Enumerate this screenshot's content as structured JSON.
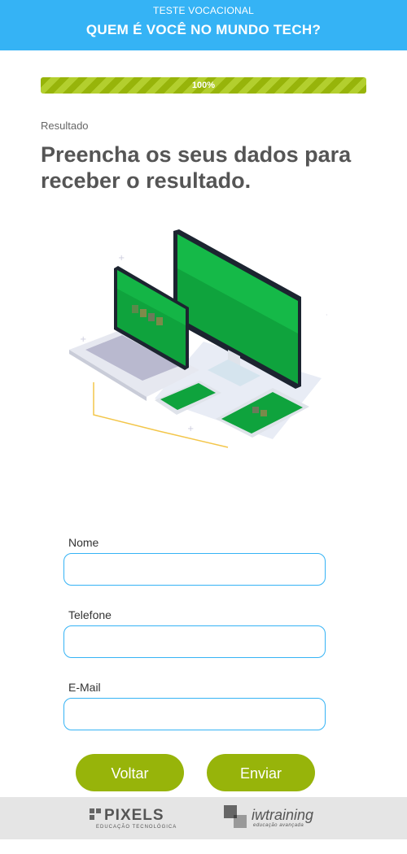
{
  "header": {
    "kicker": "TESTE VOCACIONAL",
    "title": "QUEM É VOCÊ NO MUNDO TECH?"
  },
  "progress": {
    "value": 100,
    "label": "100%"
  },
  "step": {
    "label": "Resultado"
  },
  "heading": "Preencha os seus dados para receber o resultado.",
  "illustration": {
    "icon": "devices-illustration"
  },
  "form": {
    "name_label": "Nome",
    "name_value": "",
    "phone_label": "Telefone",
    "phone_value": "",
    "email_label": "E-Mail",
    "email_value": ""
  },
  "buttons": {
    "back": "Voltar",
    "submit": "Enviar"
  },
  "footer": {
    "logo1": {
      "name": "PIXELS",
      "tagline": "EDUCAÇÃO TECNOLÓGICA"
    },
    "logo2": {
      "name": "iwtraining",
      "tagline": "educação avançada"
    }
  },
  "colors": {
    "header": "#35b3f5",
    "accent": "#97b40a",
    "field_border": "#35b3f5",
    "footer": "#e5e5e5"
  }
}
